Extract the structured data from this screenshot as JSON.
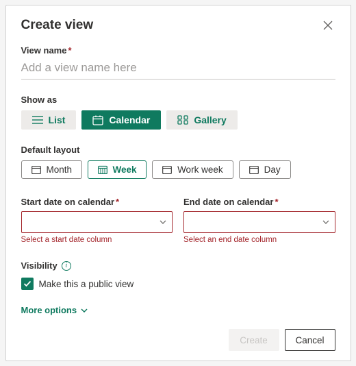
{
  "dialog": {
    "title": "Create view",
    "viewNameLabel": "View name",
    "viewNamePlaceholder": "Add a view name here",
    "showAsLabel": "Show as",
    "showAsOptions": {
      "list": "List",
      "calendar": "Calendar",
      "gallery": "Gallery"
    },
    "defaultLayoutLabel": "Default layout",
    "layoutOptions": {
      "month": "Month",
      "week": "Week",
      "workWeek": "Work week",
      "day": "Day"
    },
    "startDateLabel": "Start date on calendar",
    "startDateError": "Select a start date column",
    "endDateLabel": "End date on calendar",
    "endDateError": "Select an end date column",
    "visibilityLabel": "Visibility",
    "publicLabel": "Make this a public view",
    "moreOptions": "More options",
    "createLabel": "Create",
    "cancelLabel": "Cancel",
    "requiredMark": "*"
  }
}
